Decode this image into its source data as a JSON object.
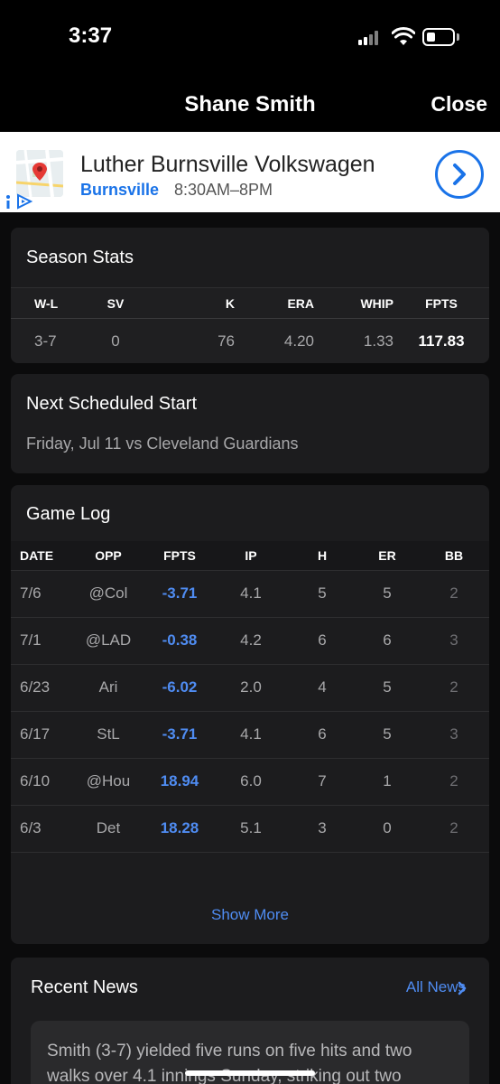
{
  "status_bar": {
    "time": "3:37"
  },
  "nav": {
    "title": "Shane Smith",
    "close_label": "Close"
  },
  "ad": {
    "title": "Luther Burnsville Volkswagen",
    "city": "Burnsville",
    "hours": "8:30AM–8PM"
  },
  "season_stats": {
    "title": "Season Stats",
    "headers": [
      "W-L",
      "SV",
      "K",
      "ERA",
      "WHIP",
      "FPTS"
    ],
    "values": [
      "3-7",
      "0",
      "76",
      "4.20",
      "1.33",
      "117.83"
    ]
  },
  "next_start": {
    "title": "Next Scheduled Start",
    "text": "Friday, Jul 11 vs Cleveland Guardians"
  },
  "game_log": {
    "title": "Game Log",
    "headers": [
      "DATE",
      "OPP",
      "FPTS",
      "IP",
      "H",
      "ER",
      "BB"
    ],
    "rows": [
      [
        "7/6",
        "@Col",
        "-3.71",
        "4.1",
        "5",
        "5",
        "2"
      ],
      [
        "7/1",
        "@LAD",
        "-0.38",
        "4.2",
        "6",
        "6",
        "3"
      ],
      [
        "6/23",
        "Ari",
        "-6.02",
        "2.0",
        "4",
        "5",
        "2"
      ],
      [
        "6/17",
        "StL",
        "-3.71",
        "4.1",
        "6",
        "5",
        "3"
      ],
      [
        "6/10",
        "@Hou",
        "18.94",
        "6.0",
        "7",
        "1",
        "2"
      ],
      [
        "6/3",
        "Det",
        "18.28",
        "5.1",
        "3",
        "0",
        "2"
      ]
    ],
    "show_more_label": "Show More"
  },
  "recent_news": {
    "title": "Recent News",
    "all_news_label": "All News",
    "snippet": "Smith (3-7) yielded five runs on five hits and two walks over 4.1 innings Sunday, striking out two"
  },
  "colors": {
    "accent": "#4f8cf2",
    "ad_blue": "#1a73e8",
    "card_bg": "#1c1c1e",
    "page_bg": "#0b0b0c"
  }
}
